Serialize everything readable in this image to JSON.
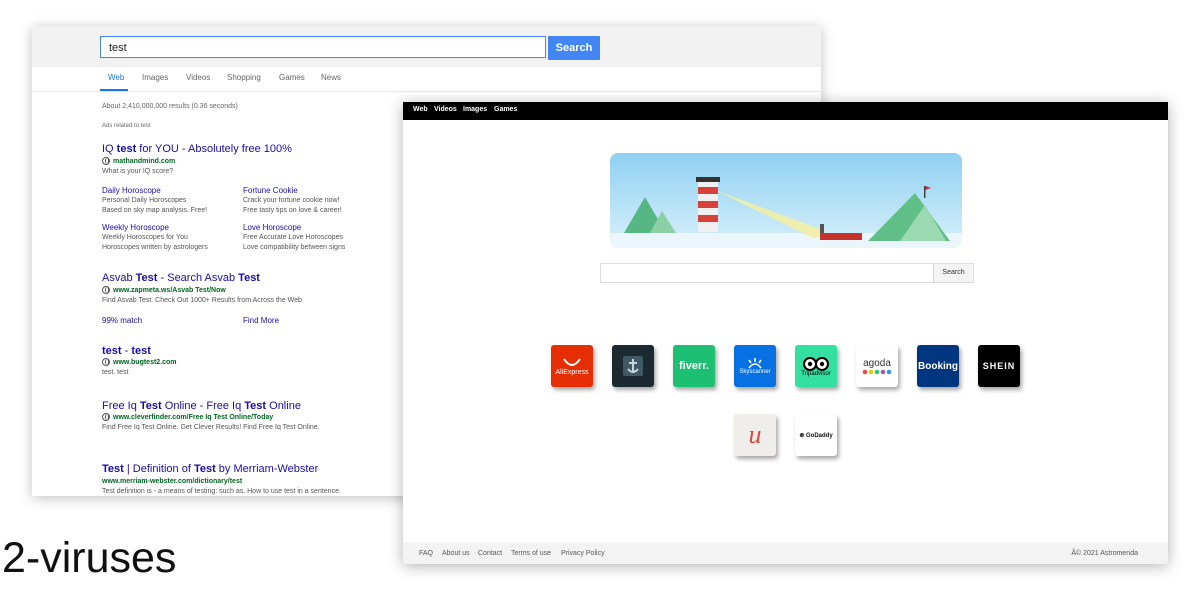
{
  "search_page": {
    "query": "test",
    "search_label": "Search",
    "tabs": [
      "Web",
      "Images",
      "Videos",
      "Shopping",
      "Games",
      "News"
    ],
    "results_count": "About 2,410,000,000 results (0.36 seconds)",
    "ads_label": "Ads related to test",
    "result1": {
      "title_pre": "IQ ",
      "title_bold": "test",
      "title_post": " for YOU - Absolutely free 100%",
      "url": "mathandmind.com",
      "desc": "What is your IQ score?",
      "sublinks": [
        {
          "title": "Daily Horoscope",
          "line1": "Personal Daily Horoscopes",
          "line2": "Based on sky map analysis. Free!"
        },
        {
          "title": "Fortune Cookie",
          "line1": "Crack your fortune cookie now!",
          "line2": "Free tasty tips on love & career!"
        },
        {
          "title": "Weekly Horoscope",
          "line1": "Weekly Horoscopes for You",
          "line2": "Horoscopes written by astrologers"
        },
        {
          "title": "Love Horoscope",
          "line1": "Free Accurate Love Horoscopes",
          "line2": "Love compatibility between signs"
        }
      ]
    },
    "result2": {
      "title_a": "Asvab ",
      "title_b": "Test",
      "title_c": " - Search Asvab ",
      "title_d": "Test",
      "url": "www.zapmeta.ws/Asvab Test/Now",
      "desc": "Find Asvab Test. Check Out 1000+ Results from Across the Web",
      "link1": "99% match",
      "link2": "Find More"
    },
    "result3": {
      "title_a": "test",
      "title_b": " - ",
      "title_c": "test",
      "url": "www.bugtest2.com",
      "desc": "test. test"
    },
    "result4": {
      "title_a": "Free Iq ",
      "title_b": "Test",
      "title_c": " Online - Free Iq ",
      "title_d": "Test",
      "title_e": " Online",
      "url": "www.cleverfinder.com/Free Iq Test Online/Today",
      "desc": "Find Free Iq Test Online. Get Clever Results! Find Free Iq Test Online."
    },
    "result5": {
      "title_a": "Test",
      "title_b": " | Definition of ",
      "title_c": "Test",
      "title_d": " by Merriam-Webster",
      "url": "www.merriam-webster.com/dictionary/test",
      "desc": "Test definition is - a means of testing: such as. How to use test in a sentence."
    }
  },
  "astromenda": {
    "nav": [
      "Web",
      "Videos",
      "Images",
      "Games"
    ],
    "search_label": "Search",
    "tiles": [
      {
        "name": "AliExpress",
        "label": "AliExpress",
        "color": "#e62e04"
      },
      {
        "name": "World of Warships",
        "label": "",
        "color": "#1b2a30"
      },
      {
        "name": "fiverr",
        "label": "fiverr.",
        "color": "#1dbf73"
      },
      {
        "name": "Skyscanner",
        "label": "Skyscanner",
        "color": "#0770e3"
      },
      {
        "name": "Tripadvisor",
        "label": "Tripadvisor",
        "color": "#34e0a1"
      },
      {
        "name": "agoda",
        "label": "agoda",
        "color": "#ffffff"
      },
      {
        "name": "Booking",
        "label": "Booking",
        "color": "#003580"
      },
      {
        "name": "SHEIN",
        "label": "SHEIN",
        "color": "#000000"
      },
      {
        "name": "Udemy",
        "label": "u",
        "color": "#f0eeea"
      },
      {
        "name": "GoDaddy",
        "label": "GoDaddy",
        "color": "#ffffff"
      }
    ],
    "footer_links": [
      "FAQ",
      "About us",
      "Contact",
      "Terms of use",
      "Privacy Policy"
    ],
    "copyright": "Â© 2021 Astromenda"
  },
  "caption": "2-viruses"
}
